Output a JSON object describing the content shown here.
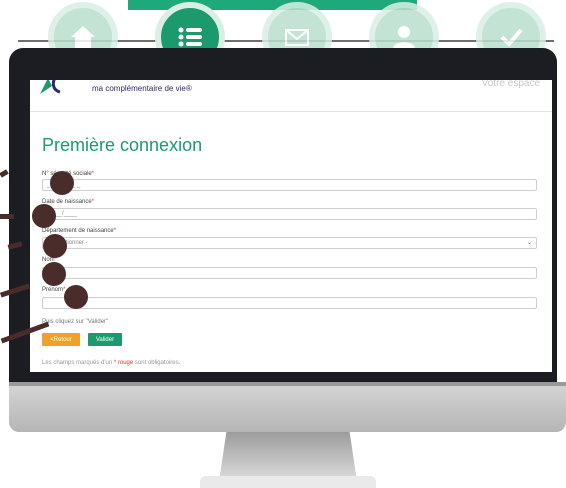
{
  "steps": [
    {
      "icon": "home-icon",
      "active": false
    },
    {
      "icon": "list-icon",
      "active": true
    },
    {
      "icon": "mail-icon",
      "active": false
    },
    {
      "icon": "user-icon",
      "active": false
    },
    {
      "icon": "check-icon",
      "active": false
    }
  ],
  "brand": {
    "tagline": "ma complémentaire de vie®",
    "right_text": "Votre espace"
  },
  "form": {
    "title": "Première connexion",
    "fields": [
      {
        "label": "N° sécurité sociale",
        "value": "_ _ _ _ _ _ _"
      },
      {
        "label": "Date de naissance",
        "value": "__/__/____"
      },
      {
        "label": "Département de naissance",
        "value": "- Sélectionner -"
      },
      {
        "label": "Nom",
        "value": ""
      },
      {
        "label": "Prénom",
        "value": ""
      }
    ],
    "hint": "Puis cliquez sur \"Valider\"",
    "back_label": "<Retour",
    "submit_label": "Valider",
    "footnote_start": "Les champs marqués d'un",
    "footnote_star": "* rouge",
    "footnote_end": "sont obligatoires."
  },
  "colors": {
    "accent": "#1c9a6e",
    "back_button": "#f0a12a",
    "required": "#d33333"
  }
}
